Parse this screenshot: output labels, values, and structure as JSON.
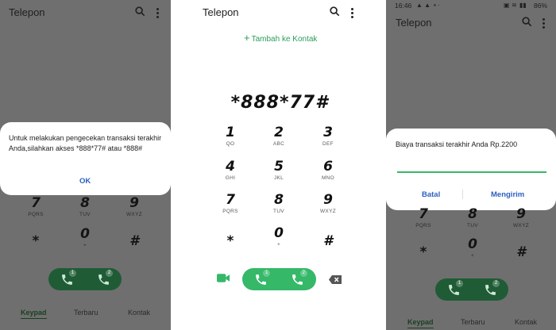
{
  "panel_left": {
    "app_title": "Telepon",
    "dialog_message": "Untuk melakukan pengecekan transaksi terakhir Anda,silahkan akses *888*77# atau *888#",
    "dialog_ok": "OK",
    "keys": [
      {
        "digit": "7",
        "letters": "PQRS"
      },
      {
        "digit": "8",
        "letters": "TUV"
      },
      {
        "digit": "9",
        "letters": "WXYZ"
      },
      {
        "digit": "*",
        "letters": ""
      },
      {
        "digit": "0",
        "letters": "+"
      },
      {
        "digit": "#",
        "letters": ""
      }
    ],
    "sim1": "1",
    "sim2": "2",
    "tabs": [
      "Keypad",
      "Terbaru",
      "Kontak"
    ]
  },
  "panel_center": {
    "app_title": "Telepon",
    "add_contact": "Tambah ke Kontak",
    "dialed_number": "*888*77#",
    "keys": [
      {
        "digit": "1",
        "letters": "QO"
      },
      {
        "digit": "2",
        "letters": "ABC"
      },
      {
        "digit": "3",
        "letters": "DEF"
      },
      {
        "digit": "4",
        "letters": "GHI"
      },
      {
        "digit": "5",
        "letters": "JKL"
      },
      {
        "digit": "6",
        "letters": "MNO"
      },
      {
        "digit": "7",
        "letters": "PQRS"
      },
      {
        "digit": "8",
        "letters": "TUV"
      },
      {
        "digit": "9",
        "letters": "WXYZ"
      },
      {
        "digit": "*",
        "letters": ""
      },
      {
        "digit": "0",
        "letters": "+"
      },
      {
        "digit": "#",
        "letters": ""
      }
    ],
    "sim1": "1",
    "sim2": "2"
  },
  "panel_right": {
    "status_time": "16:46",
    "status_battery": "86%",
    "app_title": "Telepon",
    "dialog_message": "Biaya transaksi terakhir Anda Rp.2200",
    "dialog_cancel": "Batal",
    "dialog_send": "Mengirim",
    "keys": [
      {
        "digit": "7",
        "letters": "PQRS"
      },
      {
        "digit": "8",
        "letters": "TUV"
      },
      {
        "digit": "9",
        "letters": "WXYZ"
      },
      {
        "digit": "*",
        "letters": ""
      },
      {
        "digit": "0",
        "letters": "+"
      },
      {
        "digit": "#",
        "letters": ""
      }
    ],
    "sim1": "1",
    "sim2": "2",
    "tabs": [
      "Keypad",
      "Terbaru",
      "Kontak"
    ]
  },
  "colors": {
    "accent_green": "#35b868",
    "dim_overlay": "#6f6f6f",
    "dialog_button_blue": "#2a5fbf"
  }
}
